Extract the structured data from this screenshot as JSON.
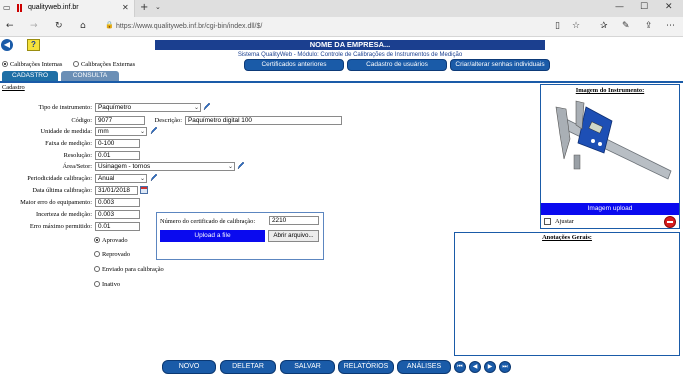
{
  "browser": {
    "tab_title": "qualityweb.inf.br",
    "url": "https://www.qualityweb.inf.br/cgi-bin/index.dll/$/"
  },
  "header": {
    "company": "NOME DA EMPRESA...",
    "subtitle": "Sistema QualityWeb - Módulo: Controle de Calibrações de Instrumentos de Medição",
    "help_label": "?"
  },
  "scope": {
    "internal_label": "Calibrações Internas",
    "external_label": "Calibrações Externas"
  },
  "top_buttons": {
    "certificates": "Certificados anteriores",
    "users": "Cadastro de usuários",
    "passwords": "Criar/alterar senhas individuais"
  },
  "tabs": {
    "cadastro": "CADASTRO",
    "consulta": "CONSULTA"
  },
  "section_title": "Cadastro",
  "form": {
    "tipo_label": "Tipo de instrumento:",
    "tipo_value": "Paquímetro",
    "codigo_label": "Código:",
    "codigo_value": "9077",
    "descricao_label": "Descrição:",
    "descricao_value": "Paquímetro digital 100",
    "unidade_label": "Unidade de medida:",
    "unidade_value": "mm",
    "faixa_label": "Faixa de medição:",
    "faixa_value": "0-100",
    "resolucao_label": "Resolução:",
    "resolucao_value": "0.01",
    "area_label": "Área/Setor:",
    "area_value": "Usinagem - tornos",
    "periodicidade_label": "Periodicidade calibração:",
    "periodicidade_value": "Anual",
    "data_label": "Data última calibração:",
    "data_value": "31/01/2018",
    "maior_erro_label": "Maior erro do equipamento:",
    "maior_erro_value": "0.003",
    "incerteza_label": "Incerteza de medição:",
    "incerteza_value": "0.003",
    "erro_max_label": "Erro máximo permitido:",
    "erro_max_value": "0.01"
  },
  "status_options": [
    {
      "label": "Aprovado",
      "selected": true
    },
    {
      "label": "Reprovado",
      "selected": false
    },
    {
      "label": "Enviado para calibração",
      "selected": false
    },
    {
      "label": "Inativo",
      "selected": false
    }
  ],
  "certificate": {
    "number_label": "Número do certificado de calibração:",
    "number_value": "2210",
    "upload_label": "Upload a file",
    "open_label": "Abrir arquivo..."
  },
  "image_panel": {
    "title": "Imagem do Instrumento:",
    "upload_label": "Imagem upload",
    "adjust_label": "Ajustar"
  },
  "notes": {
    "title": "Anotações Gerais:"
  },
  "bottom_buttons": {
    "novo": "NOVO",
    "deletar": "DELETAR",
    "salvar": "SALVAR",
    "relatorios": "RELATÓRIOS",
    "analises": "ANÁLISES"
  },
  "colors": {
    "brand_navy": "#1b3f8f",
    "button_blue": "#1a5ba8",
    "help_yellow": "#f5e23a"
  }
}
